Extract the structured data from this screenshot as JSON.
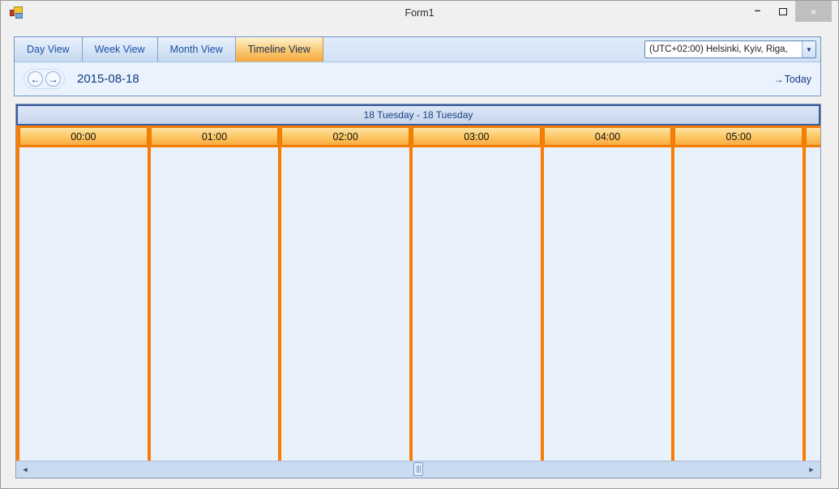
{
  "window": {
    "title": "Form1"
  },
  "icons": {
    "minimize": "–",
    "close": "×",
    "prev": "←",
    "next": "→",
    "today_arrow": "→",
    "dropdown": "▼",
    "scroll_left": "◄",
    "scroll_right": "►"
  },
  "view_tabs": {
    "items": [
      {
        "label": "Day View"
      },
      {
        "label": "Week View"
      },
      {
        "label": "Month View"
      },
      {
        "label": "Timeline View"
      }
    ],
    "active_label": "Timeline View"
  },
  "timezone_select": {
    "value": "(UTC+02:00) Helsinki, Kyiv, Riga,"
  },
  "navigation": {
    "date": "2015-08-18",
    "today": "Today"
  },
  "timeline": {
    "range_header": "18 Tuesday - 18 Tuesday",
    "hour_headers": [
      "00:00",
      "01:00",
      "02:00",
      "03:00",
      "04:00",
      "05:00"
    ]
  },
  "colors": {
    "accent_orange": "#f87d03",
    "header_blue": "#3b5c9e",
    "navy_text": "#123c7d",
    "content_bg": "#e9f1fa",
    "active_tab_orange": "#f5a93e",
    "scrollbar_track": "#c9dbf0"
  }
}
